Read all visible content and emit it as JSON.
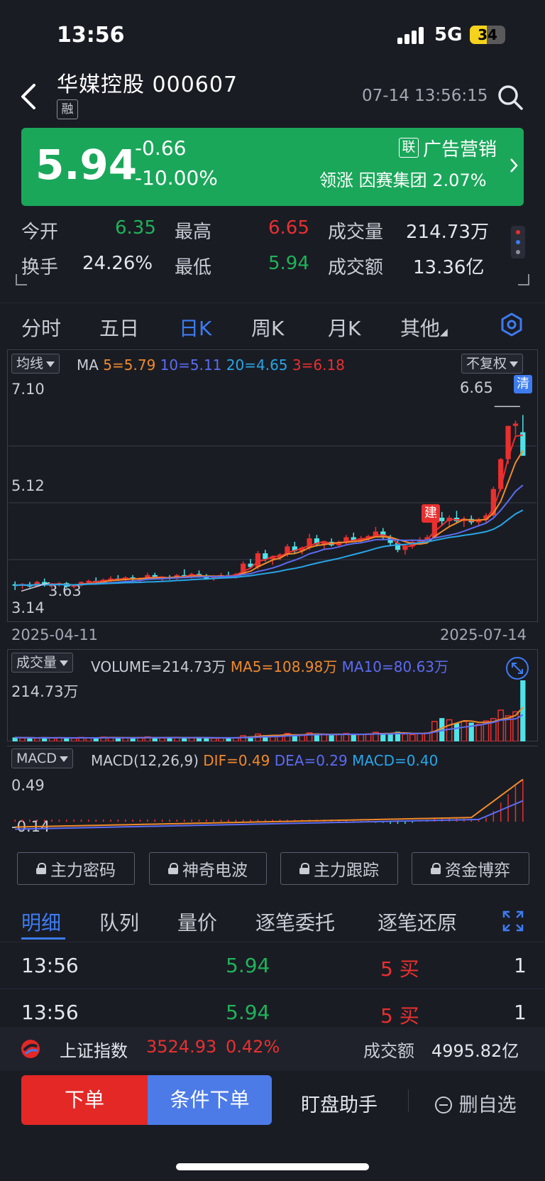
{
  "status_bar": {
    "time": "13:56",
    "network": "5G",
    "battery": "34"
  },
  "header": {
    "stock_name": "华媒控股",
    "stock_code": "000607",
    "badge": "融",
    "datetime": "07-14 13:56:15"
  },
  "quote": {
    "price": "5.94",
    "change": "-0.66",
    "change_pct": "-10.00%",
    "sector_badge": "联",
    "sector": "广告营销",
    "lead_label": "领涨",
    "lead_stock": "因赛集团",
    "lead_pct": "2.07%",
    "colors": {
      "banner": "#1aa75a",
      "up": "#e9302f",
      "down": "#20b25a"
    }
  },
  "stats": {
    "open_label": "今开",
    "open": "6.35",
    "high_label": "最高",
    "high": "6.65",
    "volume_label": "成交量",
    "volume": "214.73万",
    "turnover_label": "换手",
    "turnover": "24.26%",
    "low_label": "最低",
    "low": "5.94",
    "amount_label": "成交额",
    "amount": "13.36亿"
  },
  "chart_tabs": [
    "分时",
    "五日",
    "日K",
    "周K",
    "月K",
    "其他"
  ],
  "kline": {
    "ma_selector": "均线",
    "ma_label": "MA",
    "ma5": "5=5.79",
    "ma10": "10=5.11",
    "ma20": "20=4.65",
    "ma3": "3=6.18",
    "adjust": "不复权",
    "y_top": "7.10",
    "y_mid": "5.12",
    "y_bot": "3.14",
    "high_mark": "6.65",
    "low_mark": "3.63",
    "clear_tag": "清",
    "build_tag": "建",
    "date_start": "2025-04-11",
    "date_end": "2025-07-14"
  },
  "volume_panel": {
    "selector": "成交量",
    "volume_text": "VOLUME=214.73万",
    "ma5_text": "MA5=108.98万",
    "ma10_text": "MA10=80.63万",
    "y_top": "214.73万"
  },
  "macd_panel": {
    "selector": "MACD",
    "params": "MACD(12,26,9)",
    "dif": "DIF=0.49",
    "dea": "DEA=0.29",
    "macd": "MACD=0.40",
    "y_top": "0.49",
    "y_bot": "-0.14"
  },
  "chart_data": [
    {
      "type": "candlestick",
      "title": "",
      "x_start": "2025-04-11",
      "x_end": "2025-07-14",
      "ylim": [
        3.14,
        7.1
      ],
      "series": [
        {
          "name": "MA5",
          "color": "#f08a2a",
          "last": 5.79
        },
        {
          "name": "MA10",
          "color": "#5b6cf0",
          "last": 5.11
        },
        {
          "name": "MA20",
          "color": "#27a7e8",
          "last": 4.65
        },
        {
          "name": "MA3",
          "color": "#e9302f",
          "last": 6.18
        }
      ],
      "candles": [
        [
          3.7,
          3.75,
          3.6,
          3.68
        ],
        [
          3.68,
          3.72,
          3.62,
          3.7
        ],
        [
          3.7,
          3.74,
          3.64,
          3.66
        ],
        [
          3.66,
          3.76,
          3.65,
          3.74
        ],
        [
          3.74,
          3.8,
          3.66,
          3.68
        ],
        [
          3.68,
          3.72,
          3.63,
          3.7
        ],
        [
          3.7,
          3.74,
          3.66,
          3.72
        ],
        [
          3.72,
          3.74,
          3.64,
          3.66
        ],
        [
          3.66,
          3.7,
          3.63,
          3.68
        ],
        [
          3.68,
          3.75,
          3.66,
          3.74
        ],
        [
          3.74,
          3.78,
          3.7,
          3.76
        ],
        [
          3.76,
          3.82,
          3.72,
          3.74
        ],
        [
          3.74,
          3.8,
          3.72,
          3.78
        ],
        [
          3.78,
          3.84,
          3.74,
          3.8
        ],
        [
          3.8,
          3.86,
          3.76,
          3.78
        ],
        [
          3.78,
          3.84,
          3.74,
          3.82
        ],
        [
          3.82,
          3.86,
          3.76,
          3.78
        ],
        [
          3.78,
          3.82,
          3.74,
          3.8
        ],
        [
          3.8,
          3.9,
          3.78,
          3.86
        ],
        [
          3.86,
          3.9,
          3.78,
          3.8
        ],
        [
          3.8,
          3.84,
          3.76,
          3.82
        ],
        [
          3.82,
          3.86,
          3.78,
          3.8
        ],
        [
          3.8,
          3.88,
          3.78,
          3.86
        ],
        [
          3.86,
          3.96,
          3.82,
          3.84
        ],
        [
          3.84,
          3.9,
          3.8,
          3.88
        ],
        [
          3.88,
          3.94,
          3.82,
          3.84
        ],
        [
          3.84,
          3.88,
          3.78,
          3.8
        ],
        [
          3.8,
          3.86,
          3.76,
          3.84
        ],
        [
          3.84,
          3.9,
          3.8,
          3.86
        ],
        [
          3.86,
          3.92,
          3.82,
          3.84
        ],
        [
          3.84,
          3.9,
          3.8,
          3.88
        ],
        [
          3.88,
          4.1,
          3.86,
          4.06
        ],
        [
          4.06,
          4.14,
          3.98,
          4.0
        ],
        [
          4.0,
          4.28,
          3.96,
          4.24
        ],
        [
          4.24,
          4.3,
          4.1,
          4.14
        ],
        [
          4.14,
          4.2,
          4.04,
          4.18
        ],
        [
          4.18,
          4.24,
          4.12,
          4.22
        ],
        [
          4.22,
          4.4,
          4.18,
          4.36
        ],
        [
          4.36,
          4.44,
          4.24,
          4.28
        ],
        [
          4.28,
          4.36,
          4.22,
          4.34
        ],
        [
          4.34,
          4.58,
          4.3,
          4.5
        ],
        [
          4.5,
          4.56,
          4.36,
          4.4
        ],
        [
          4.4,
          4.46,
          4.32,
          4.44
        ],
        [
          4.44,
          4.5,
          4.36,
          4.38
        ],
        [
          4.38,
          4.46,
          4.34,
          4.42
        ],
        [
          4.42,
          4.56,
          4.4,
          4.52
        ],
        [
          4.52,
          4.6,
          4.44,
          4.46
        ],
        [
          4.46,
          4.54,
          4.42,
          4.5
        ],
        [
          4.5,
          4.56,
          4.46,
          4.54
        ],
        [
          4.54,
          4.7,
          4.52,
          4.62
        ],
        [
          4.62,
          4.68,
          4.48,
          4.52
        ],
        [
          4.52,
          4.56,
          4.38,
          4.42
        ],
        [
          4.42,
          4.46,
          4.26,
          4.3
        ],
        [
          4.3,
          4.4,
          4.22,
          4.36
        ],
        [
          4.36,
          4.48,
          4.32,
          4.44
        ],
        [
          4.44,
          4.52,
          4.4,
          4.48
        ],
        [
          4.48,
          4.56,
          4.44,
          4.52
        ],
        [
          4.52,
          4.9,
          4.5,
          4.86
        ],
        [
          4.86,
          4.96,
          4.72,
          4.8
        ],
        [
          4.8,
          4.9,
          4.7,
          4.86
        ],
        [
          4.86,
          4.98,
          4.78,
          4.8
        ],
        [
          4.8,
          4.88,
          4.7,
          4.84
        ],
        [
          4.84,
          4.9,
          4.74,
          4.78
        ],
        [
          4.78,
          4.86,
          4.72,
          4.82
        ],
        [
          4.82,
          4.94,
          4.78,
          4.9
        ],
        [
          4.9,
          5.4,
          4.88,
          5.36
        ],
        [
          5.36,
          5.9,
          5.32,
          5.88
        ],
        [
          5.88,
          6.46,
          5.8,
          6.46
        ],
        [
          6.46,
          6.55,
          6.3,
          6.5
        ],
        [
          6.35,
          6.65,
          5.94,
          5.94
        ]
      ]
    },
    {
      "type": "bar",
      "title": "",
      "ylim": [
        0,
        214.73
      ],
      "unit": "万",
      "values": [
        14,
        12,
        13,
        11,
        15,
        12,
        13,
        12,
        11,
        14,
        13,
        12,
        15,
        14,
        13,
        12,
        11,
        14,
        16,
        13,
        12,
        14,
        13,
        15,
        12,
        13,
        12,
        11,
        13,
        14,
        12,
        20,
        18,
        26,
        22,
        20,
        22,
        28,
        24,
        22,
        30,
        26,
        24,
        22,
        24,
        28,
        26,
        24,
        26,
        32,
        30,
        28,
        34,
        26,
        24,
        28,
        30,
        70,
        82,
        76,
        64,
        70,
        66,
        60,
        72,
        80,
        110,
        90,
        104,
        214.73
      ],
      "series": [
        {
          "name": "MA5",
          "color": "#f08a2a",
          "last": 108.98
        },
        {
          "name": "MA10",
          "color": "#5b6cf0",
          "last": 80.63
        }
      ]
    },
    {
      "type": "bar",
      "title": "",
      "ylim": [
        -0.14,
        0.49
      ],
      "values": [
        0.02,
        0.02,
        0.02,
        0.02,
        0.02,
        0.02,
        0.02,
        0.02,
        0.02,
        0.02,
        0.02,
        0.02,
        0.02,
        0.02,
        0.02,
        0.02,
        0.02,
        0.02,
        0.02,
        0.02,
        0.02,
        0.02,
        0.02,
        0.02,
        0.02,
        0.02,
        0.02,
        0.02,
        0.02,
        0.02,
        0.02,
        0.02,
        0.02,
        0.02,
        0.02,
        0.02,
        0.02,
        0.02,
        0.02,
        0.02,
        0.02,
        0.02,
        0.02,
        0.02,
        0.02,
        0.02,
        0.01,
        0.01,
        0.01,
        -0.01,
        -0.01,
        -0.02,
        -0.02,
        -0.02,
        -0.01,
        0.01,
        0.02,
        0.03,
        0.03,
        0.03,
        0.03,
        0.03,
        0.02,
        0.02,
        0.04,
        0.1,
        0.18,
        0.26,
        0.34,
        0.4
      ],
      "series": [
        {
          "name": "DIF",
          "color": "#f08a2a",
          "last": 0.49
        },
        {
          "name": "DEA",
          "color": "#5b6cf0",
          "last": 0.29
        }
      ]
    }
  ],
  "feature_buttons": [
    "主力密码",
    "神奇电波",
    "主力跟踪",
    "资金博弈"
  ],
  "detail_tabs": [
    "明细",
    "队列",
    "量价",
    "逐笔委托",
    "逐笔还原"
  ],
  "trades": [
    {
      "time": "13:56",
      "price": "5.94",
      "vol": "5 买",
      "count": "1"
    },
    {
      "time": "13:56",
      "price": "5.94",
      "vol": "5 买",
      "count": "1"
    }
  ],
  "index_bar": {
    "name": "上证指数",
    "value": "3524.93",
    "pct": "0.42%",
    "amount_label": "成交额",
    "amount": "4995.82亿"
  },
  "bottom_bar": {
    "order": "下单",
    "cond_order": "条件下单",
    "helper": "盯盘助手",
    "remove": "删自选"
  }
}
